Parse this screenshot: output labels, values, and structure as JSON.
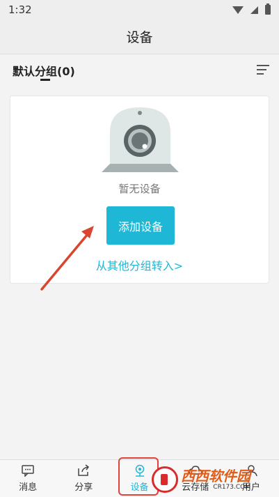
{
  "status_bar": {
    "time": "1:32"
  },
  "header": {
    "title": "设备"
  },
  "group": {
    "name": "默认分组(0)"
  },
  "empty_state": {
    "message": "暂无设备",
    "add_button": "添加设备",
    "transfer_link": "从其他分组转入>"
  },
  "tabs": [
    {
      "label": "消息",
      "icon": "message-icon"
    },
    {
      "label": "分享",
      "icon": "share-icon"
    },
    {
      "label": "设备",
      "icon": "device-icon",
      "active": true
    },
    {
      "label": "云存储",
      "icon": "cloud-icon"
    },
    {
      "label": "用户",
      "icon": "user-icon"
    }
  ],
  "watermark": {
    "main": "西西软件园",
    "sub": "CR173.COM"
  },
  "colors": {
    "accent": "#1fb7d6",
    "highlight": "#e0433c",
    "arrow": "#d9452e"
  }
}
